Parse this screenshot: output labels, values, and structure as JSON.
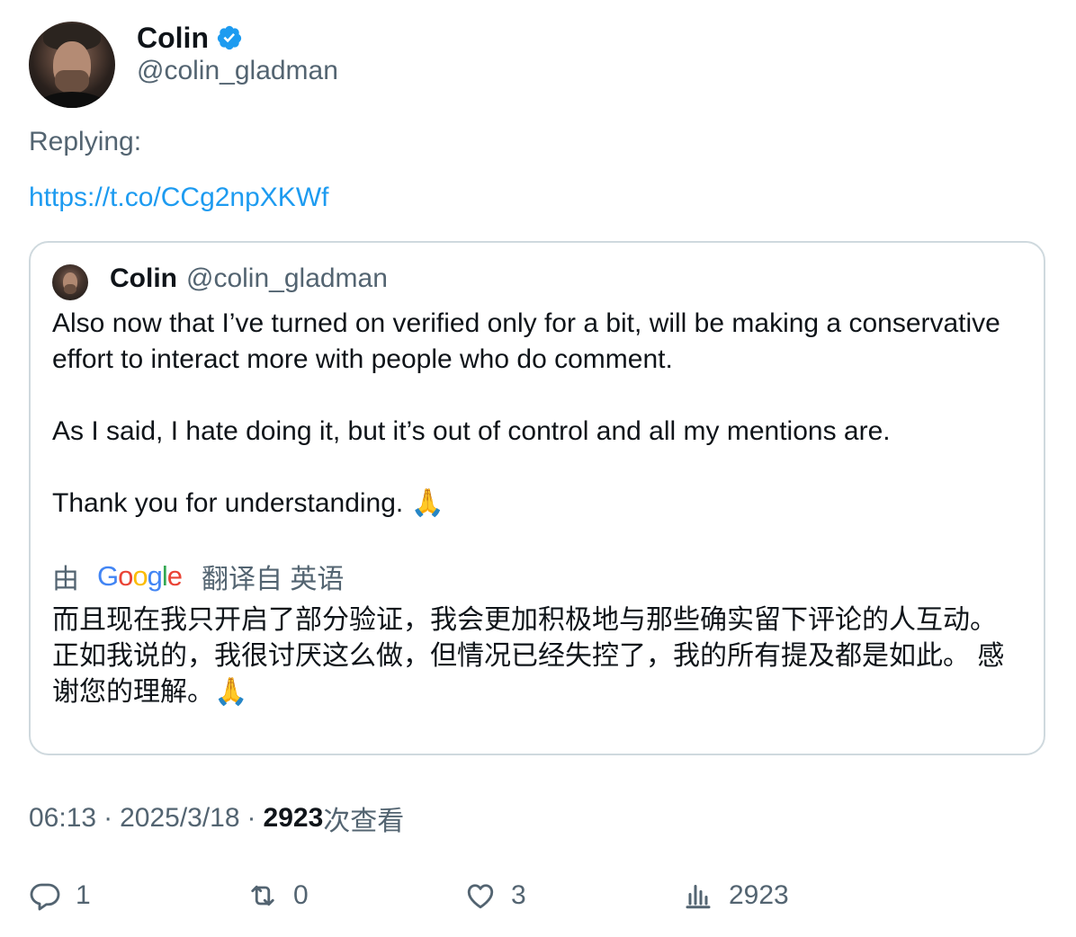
{
  "author": {
    "display_name": "Colin",
    "handle": "@colin_gladman",
    "verified": true,
    "verified_color": "#1d9bf0"
  },
  "reply": {
    "label": "Replying:",
    "link": "https://t.co/CCg2npXKWf"
  },
  "quoted_tweet": {
    "display_name": "Colin",
    "handle": "@colin_gladman",
    "paragraphs": [
      "Also now that I’ve turned on verified only for a bit, will be making a conservative effort to interact more with people who do comment.",
      "As I said, I hate doing it, but it’s out of control and all my mentions are.",
      "Thank you for understanding. 🙏"
    ],
    "translation": {
      "prefix": "由",
      "provider": "Google",
      "suffix": "翻译自 英语",
      "text": "而且现在我只开启了部分验证，我会更加积极地与那些确实留下评论的人互动。 正如我说的，我很讨厌这么做，但情况已经失控了，我的所有提及都是如此。 感谢您的理解。🙏"
    }
  },
  "meta": {
    "time": "06:13",
    "separator": "·",
    "date": "2025/3/18",
    "views_count": "2923",
    "views_label": "次查看"
  },
  "actions": {
    "replies": "1",
    "retweets": "0",
    "likes": "3",
    "views": "2923"
  },
  "colors": {
    "text_primary": "#0f1419",
    "text_secondary": "#536471",
    "link": "#1d9bf0",
    "border": "#cfd9de"
  }
}
